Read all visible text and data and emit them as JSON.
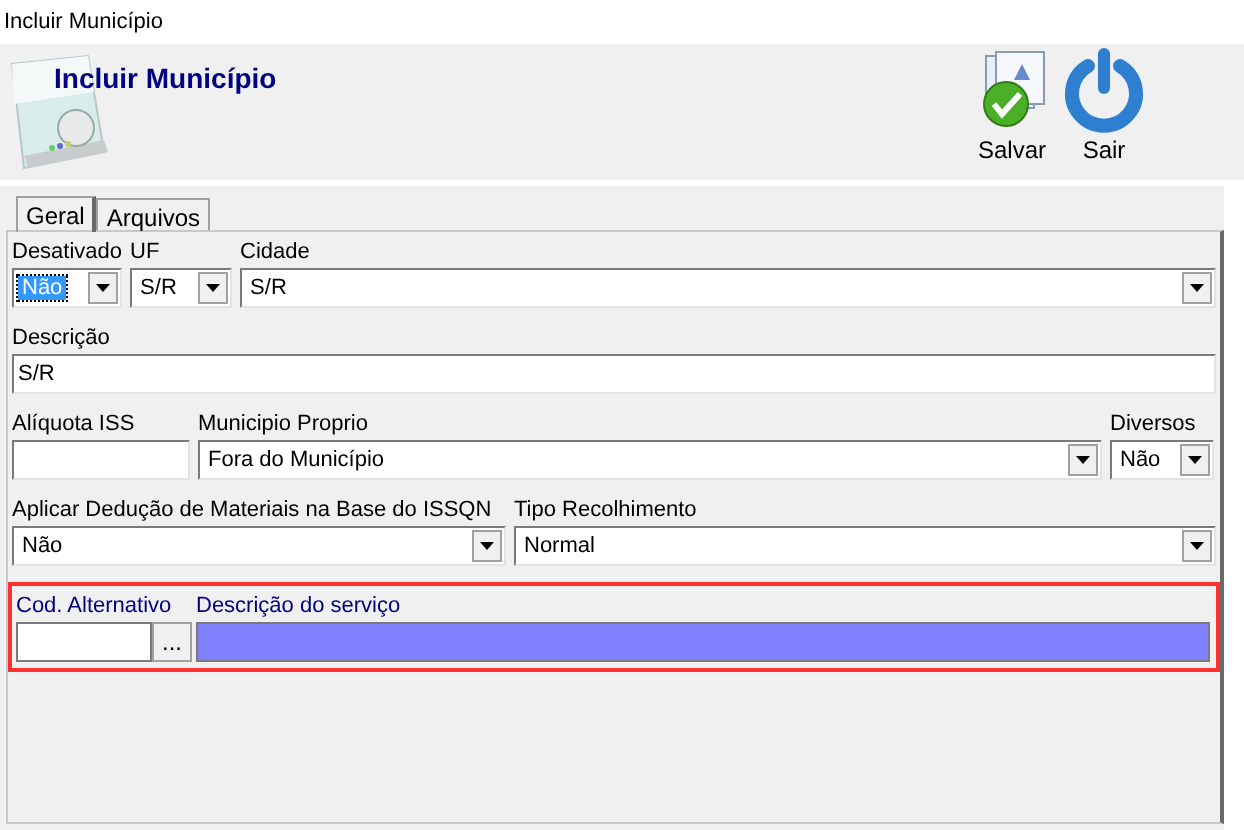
{
  "window": {
    "title": "Incluir Município"
  },
  "header": {
    "title": "Incluir Município",
    "buttons": [
      {
        "label": "Salvar",
        "kind": "save"
      },
      {
        "label": "Sair",
        "kind": "exit"
      }
    ]
  },
  "tabs": [
    {
      "label": "Geral",
      "selected": true
    },
    {
      "label": "Arquivos",
      "selected": false
    }
  ],
  "rows": [
    [
      {
        "label": "Desativado",
        "kind": "combo",
        "value": "Não",
        "focused": true
      },
      {
        "label": "UF",
        "kind": "combo",
        "value": "S/R",
        "focused": false
      },
      {
        "label": "Cidade",
        "kind": "combo",
        "value": "S/R",
        "focused": false
      }
    ],
    [
      {
        "label": "Descrição",
        "kind": "text",
        "value": "S/R"
      }
    ],
    [
      {
        "label": "Alíquota ISS",
        "kind": "text"
      },
      {
        "label": "Municipio Proprio",
        "kind": "combo",
        "value": "Fora do Município",
        "focused": false
      },
      {
        "label": "Diversos",
        "kind": "combo",
        "value": "Não",
        "focused": false
      }
    ],
    [
      {
        "label": "Aplicar Dedução de Materiais na Base do ISSQN",
        "kind": "combo",
        "value": "Não",
        "focused": false
      },
      {
        "label": "Tipo Recolhimento",
        "kind": "combo",
        "value": "Normal",
        "focused": false
      }
    ]
  ],
  "service": {
    "outlined": true,
    "code_label": "Cod. Alternativo",
    "lookup_button": "...",
    "description_label": "Descrição do serviço",
    "description_highlighted": true
  }
}
